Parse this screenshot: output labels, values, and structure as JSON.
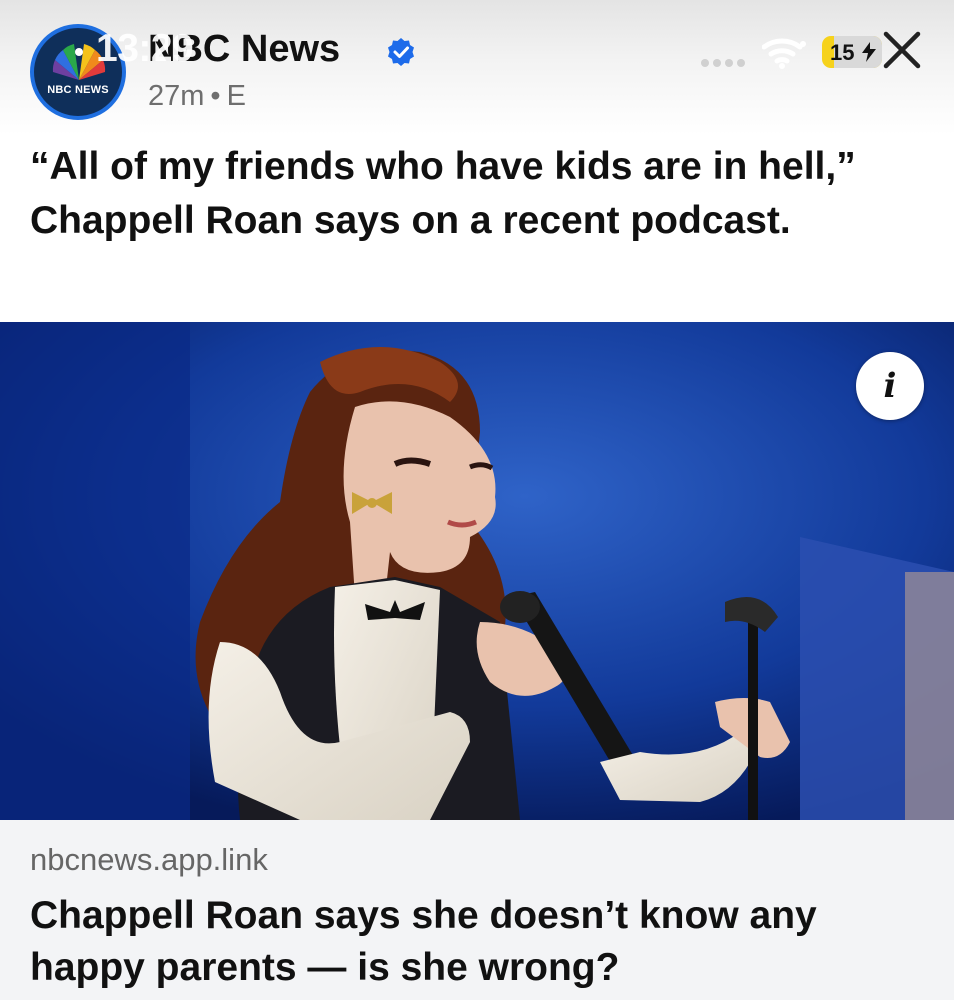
{
  "status_bar": {
    "time": "13:29",
    "battery": "15"
  },
  "post": {
    "account_name": "NBC News",
    "avatar_text": "NBC NEWS",
    "time_ago": "27m",
    "meta_separator": "•",
    "edited_marker": "E",
    "headline": "“All of my friends who have kids are in hell,” Chappell Roan says on a recent podcast."
  },
  "icons": {
    "close": "close-icon",
    "verified": "verified-badge-icon",
    "info": "info-icon",
    "wifi": "wifi-icon",
    "battery": "battery-icon",
    "logo": "nbc-peacock-icon"
  },
  "info_button_label": "i",
  "link_card": {
    "domain": "nbcnews.app.link",
    "title": "Chappell Roan says she doesn’t know any happy parents — is she wrong?"
  },
  "colors": {
    "verified_blue": "#1d6bea",
    "avatar_ring": "#1f6fe0",
    "battery_yellow": "#f6d21c",
    "stage_blue": "#0b2f8a",
    "card_bg": "#f3f4f6"
  }
}
